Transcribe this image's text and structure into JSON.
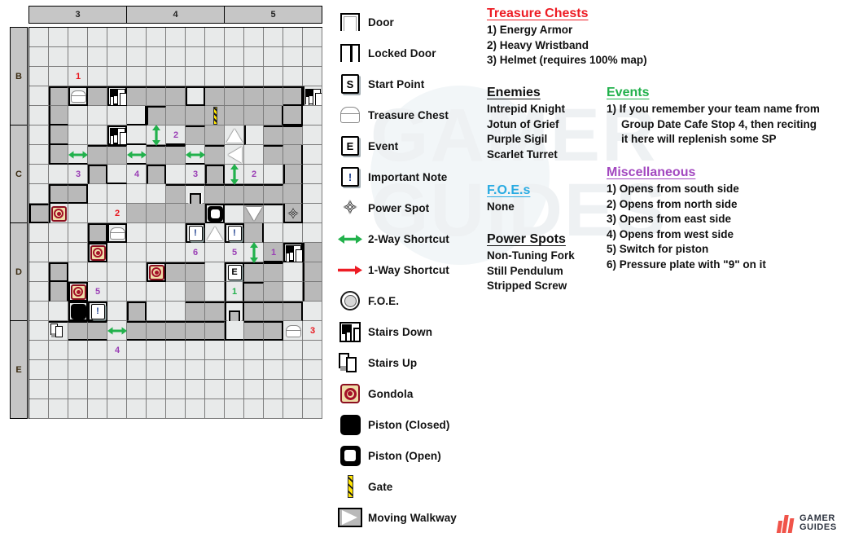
{
  "map": {
    "col_headers": [
      "3",
      "4",
      "5"
    ],
    "row_headers": [
      "B",
      "C",
      "D",
      "E"
    ],
    "markers": [
      {
        "col": 2,
        "row": 2,
        "kind": "num",
        "text": "1",
        "color": "red"
      },
      {
        "col": 2,
        "row": 3,
        "kind": "chest"
      },
      {
        "col": 4,
        "row": 3,
        "kind": "stairs-down"
      },
      {
        "col": 14,
        "row": 3,
        "kind": "stairs-down"
      },
      {
        "col": 9,
        "row": 4,
        "kind": "gate"
      },
      {
        "col": 4,
        "row": 5,
        "kind": "stairs-down"
      },
      {
        "col": 6,
        "row": 5,
        "kind": "arrow-v"
      },
      {
        "col": 7,
        "row": 5,
        "kind": "num",
        "text": "2",
        "color": "purple"
      },
      {
        "col": 10,
        "row": 5,
        "kind": "tri-up"
      },
      {
        "col": 2,
        "row": 6,
        "kind": "arrow-h"
      },
      {
        "col": 5,
        "row": 6,
        "kind": "arrow-h"
      },
      {
        "col": 8,
        "row": 6,
        "kind": "arrow-h"
      },
      {
        "col": 10,
        "row": 6,
        "kind": "tri-left"
      },
      {
        "col": 2,
        "row": 7,
        "kind": "num",
        "text": "3",
        "color": "purple"
      },
      {
        "col": 5,
        "row": 7,
        "kind": "num",
        "text": "4",
        "color": "purple"
      },
      {
        "col": 8,
        "row": 7,
        "kind": "num",
        "text": "3",
        "color": "purple"
      },
      {
        "col": 10,
        "row": 7,
        "kind": "arrow-v"
      },
      {
        "col": 11,
        "row": 7,
        "kind": "num",
        "text": "2",
        "color": "purple"
      },
      {
        "col": 8,
        "row": 8,
        "kind": "door"
      },
      {
        "col": 1,
        "row": 9,
        "kind": "gondola"
      },
      {
        "col": 4,
        "row": 9,
        "kind": "num",
        "text": "2",
        "color": "red"
      },
      {
        "col": 9,
        "row": 9,
        "kind": "piston-open"
      },
      {
        "col": 11,
        "row": 9,
        "kind": "tri-down"
      },
      {
        "col": 13,
        "row": 9,
        "kind": "power-spot"
      },
      {
        "col": 4,
        "row": 10,
        "kind": "chest"
      },
      {
        "col": 8,
        "row": 10,
        "kind": "note"
      },
      {
        "col": 9,
        "row": 10,
        "kind": "tri-up"
      },
      {
        "col": 10,
        "row": 10,
        "kind": "note"
      },
      {
        "col": 3,
        "row": 11,
        "kind": "gondola"
      },
      {
        "col": 8,
        "row": 11,
        "kind": "num",
        "text": "6",
        "color": "purple"
      },
      {
        "col": 10,
        "row": 11,
        "kind": "num",
        "text": "5",
        "color": "purple"
      },
      {
        "col": 11,
        "row": 11,
        "kind": "arrow-v"
      },
      {
        "col": 12,
        "row": 11,
        "kind": "num",
        "text": "1",
        "color": "purple"
      },
      {
        "col": 13,
        "row": 11,
        "kind": "stairs-down"
      },
      {
        "col": 6,
        "row": 12,
        "kind": "gondola"
      },
      {
        "col": 10,
        "row": 12,
        "kind": "event"
      },
      {
        "col": 2,
        "row": 13,
        "kind": "gondola"
      },
      {
        "col": 3,
        "row": 13,
        "kind": "num",
        "text": "5",
        "color": "purple"
      },
      {
        "col": 10,
        "row": 13,
        "kind": "num",
        "text": "1",
        "color": "green"
      },
      {
        "col": 2,
        "row": 14,
        "kind": "piston-closed"
      },
      {
        "col": 3,
        "row": 14,
        "kind": "note"
      },
      {
        "col": 10,
        "row": 14,
        "kind": "door"
      },
      {
        "col": 1,
        "row": 15,
        "kind": "stairs-up"
      },
      {
        "col": 4,
        "row": 15,
        "kind": "arrow-h"
      },
      {
        "col": 13,
        "row": 15,
        "kind": "chest"
      },
      {
        "col": 14,
        "row": 15,
        "kind": "num",
        "text": "3",
        "color": "red"
      },
      {
        "col": 4,
        "row": 16,
        "kind": "num",
        "text": "4",
        "color": "purple"
      }
    ]
  },
  "legend": {
    "items": [
      {
        "icon": "door-icon",
        "label": "Door"
      },
      {
        "icon": "locked-door-icon",
        "label": "Locked Door"
      },
      {
        "icon": "start-point-icon",
        "label": "Start Point",
        "glyph": "S"
      },
      {
        "icon": "treasure-chest-icon",
        "label": "Treasure Chest"
      },
      {
        "icon": "event-icon",
        "label": "Event",
        "glyph": "E"
      },
      {
        "icon": "important-note-icon",
        "label": "Important Note",
        "glyph": "!"
      },
      {
        "icon": "power-spot-icon",
        "label": "Power Spot"
      },
      {
        "icon": "two-way-shortcut-icon",
        "label": "2-Way Shortcut"
      },
      {
        "icon": "one-way-shortcut-icon",
        "label": "1-Way Shortcut"
      },
      {
        "icon": "foe-icon",
        "label": "F.O.E."
      },
      {
        "icon": "stairs-down-icon",
        "label": "Stairs Down"
      },
      {
        "icon": "stairs-up-icon",
        "label": "Stairs Up"
      },
      {
        "icon": "gondola-icon",
        "label": "Gondola"
      },
      {
        "icon": "piston-closed-icon",
        "label": "Piston (Closed)"
      },
      {
        "icon": "piston-open-icon",
        "label": "Piston (Open)"
      },
      {
        "icon": "gate-icon",
        "label": "Gate"
      },
      {
        "icon": "moving-walkway-icon",
        "label": "Moving Walkway"
      }
    ]
  },
  "panels": {
    "treasure_chests": {
      "title": "Treasure Chests",
      "color": "#ed1c24",
      "lines": [
        "1) Energy Armor",
        "2) Heavy Wristband",
        "3) Helmet (requires 100% map)"
      ]
    },
    "enemies": {
      "title": "Enemies",
      "color": "#111111",
      "lines": [
        "Intrepid Knight",
        "Jotun of Grief",
        "Purple Sigil",
        "Scarlet Turret"
      ]
    },
    "foes": {
      "title": "F.O.E.s",
      "color": "#29abe2",
      "lines": [
        "None"
      ]
    },
    "power_spots": {
      "title": "Power Spots",
      "color": "#111111",
      "lines": [
        "Non-Tuning Fork",
        "Still Pendulum",
        "Stripped Screw"
      ]
    },
    "events": {
      "title": "Events",
      "color": "#22b14c",
      "lines": [
        "1) If you remember your team name from",
        "Group Date Cafe Stop 4, then reciting",
        "it here will replenish some SP"
      ]
    },
    "miscellaneous": {
      "title": "Miscellaneous",
      "color": "#a348c0",
      "lines": [
        "1) Opens from south side",
        "2) Opens from north side",
        "3) Opens from east side",
        "4) Opens from west side",
        "5) Switch for piston",
        "6) Pressure plate with \"9\" on it"
      ]
    }
  },
  "watermark": {
    "line1": "GAMER",
    "line2": "GUIDES"
  },
  "logo": {
    "line1": "GAMER",
    "line2": "GUIDES"
  }
}
